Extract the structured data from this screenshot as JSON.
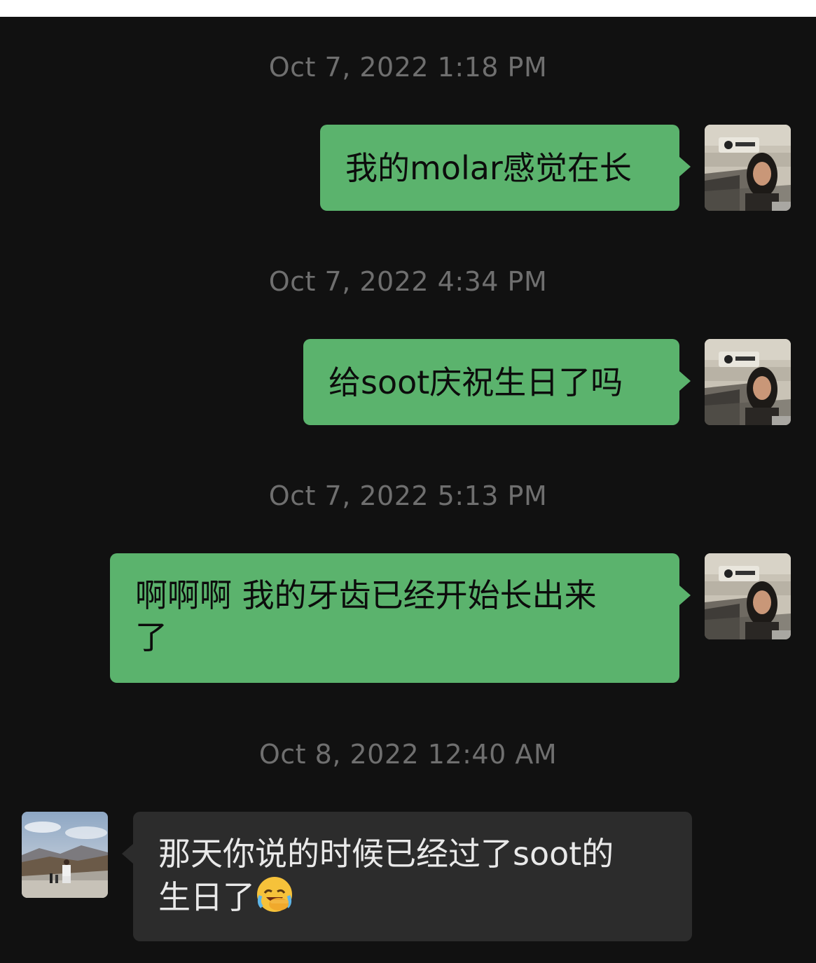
{
  "colors": {
    "outgoing_bubble": "#5bb36d",
    "incoming_bubble": "#2c2c2c",
    "background": "#111111",
    "timestamp_text": "#6f6f6f"
  },
  "messages": [
    {
      "timestamp": "Oct 7, 2022 1:18 PM",
      "sender": "self",
      "text": "我的molar感觉在长",
      "avatar_icon": "profile-photo-woman-train"
    },
    {
      "timestamp": "Oct 7, 2022 4:34 PM",
      "sender": "self",
      "text": "给soot庆祝生日了吗",
      "avatar_icon": "profile-photo-woman-train"
    },
    {
      "timestamp": "Oct 7, 2022 5:13 PM",
      "sender": "self",
      "text_line1": "啊啊啊 我的牙齿已经开始长出来",
      "text_line2": "了",
      "avatar_icon": "profile-photo-woman-train"
    },
    {
      "timestamp": "Oct 8, 2022 12:40 AM",
      "sender": "other",
      "text_line1": "那天你说的时候已经过了soot的",
      "text_line2": "生日了",
      "emoji": "face-with-hand-over-mouth-laughing-crying",
      "avatar_icon": "profile-photo-mountain-landscape"
    }
  ]
}
